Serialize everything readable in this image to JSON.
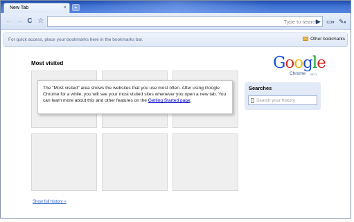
{
  "tab": {
    "title": "New Tab",
    "close": "×",
    "new_tab": "+"
  },
  "toolbar": {
    "back": "←",
    "forward": "→",
    "reload": "C",
    "star": "☆",
    "omnibox_placeholder": "Type to search",
    "go": "▶",
    "page_menu": "▭",
    "tools_menu": "✎",
    "caret": "▾"
  },
  "bookmarks_bar": {
    "hint": "For quick access, place your bookmarks here in the bookmarks bar.",
    "other_bookmarks": "Other bookmarks"
  },
  "new_tab_page": {
    "most_visited_heading": "Most visited",
    "info_text_before_link": "The \"Most visited\" area shows the websites that you use most often. After using Google Chrome for a while, you will see your most visited sites whenever you open a new tab. You can learn more about this and other features on the ",
    "info_link": "Getting Started page",
    "info_text_after_link": ".",
    "show_full_history": "Show full history »"
  },
  "logo": {
    "letters": [
      "G",
      "o",
      "o",
      "g",
      "l",
      "e"
    ],
    "letter_colors": [
      "#1a4fd6",
      "#d62b1f",
      "#f0b400",
      "#1a4fd6",
      "#1a9e2a",
      "#d62b1f"
    ],
    "product": "Chrome",
    "beta": "BETA"
  },
  "searches": {
    "title": "Searches",
    "placeholder": "Search your history"
  }
}
